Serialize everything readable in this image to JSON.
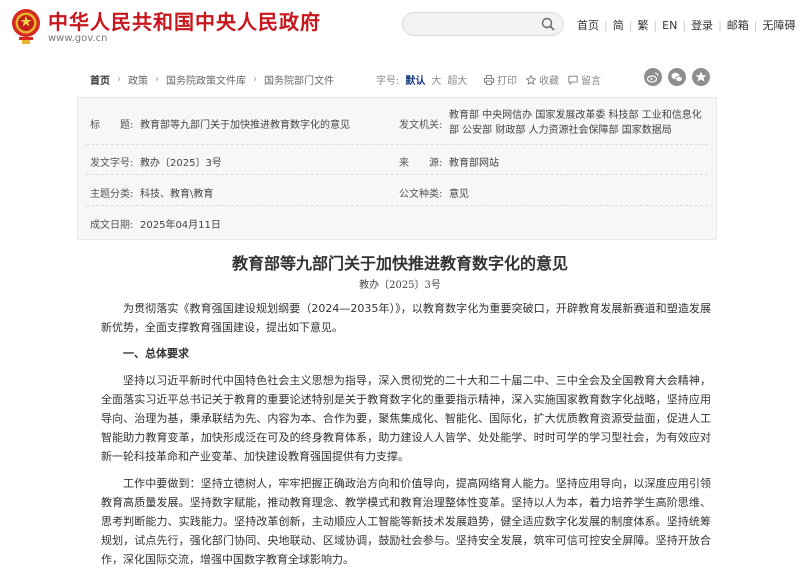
{
  "header": {
    "site_name": "中华人民共和国中央人民政府",
    "site_url": "www.gov.cn",
    "search_placeholder": "",
    "nav": [
      "首页",
      "简",
      "繁",
      "EN",
      "登录",
      "邮箱",
      "无障碍"
    ]
  },
  "breadcrumb": [
    "首页",
    "政策",
    "国务院政策文件库",
    "国务院部门文件"
  ],
  "font_size": {
    "label": "字号:",
    "options": [
      "默认",
      "大",
      "超大"
    ],
    "selected": "默认"
  },
  "tools": [
    "打印",
    "收藏",
    "留言"
  ],
  "colors": {
    "brand_red": "#c8161d",
    "accent_blue": "#1a3c82"
  },
  "meta": {
    "title_label": "标　　题:",
    "title_value": "教育部等九部门关于加快推进教育数字化的意见",
    "issuer_label": "发文机关:",
    "issuer_value": "教育部 中央网信办 国家发展改革委 科技部 工业和信息化部 公安部 财政部 人力资源社会保障部 国家数据局",
    "docno_label": "发文字号:",
    "docno_value": "教办〔2025〕3号",
    "source_label": "来　　源:",
    "source_value": "教育部网站",
    "topic_label": "主题分类:",
    "topic_value": "科技、教育\\教育",
    "type_label": "公文种类:",
    "type_value": "意见",
    "date_label": "成文日期:",
    "date_value": "2025年04月11日"
  },
  "doc": {
    "title": "教育部等九部门关于加快推进教育数字化的意见",
    "number": "教办〔2025〕3号",
    "p1": "为贯彻落实《教育强国建设规划纲要（2024—2035年）》，以教育数字化为重要突破口，开辟教育发展新赛道和塑造发展新优势，全面支撑教育强国建设，提出如下意见。",
    "h1": "一、总体要求",
    "p2": "坚持以习近平新时代中国特色社会主义思想为指导，深入贯彻党的二十大和二十届二中、三中全会及全国教育大会精神，全面落实习近平总书记关于教育的重要论述特别是关于教育数字化的重要指示精神，深入实施国家教育数字化战略，坚持应用导向、治理为基，秉承联结为先、内容为本、合作为要，聚焦集成化、智能化、国际化，扩大优质教育资源受益面，促进人工智能助力教育变革，加快形成泛在可及的终身教育体系，助力建设人人皆学、处处能学、时时可学的学习型社会，为有效应对新一轮科技革命和产业变革、加快建设教育强国提供有力支撑。",
    "p3": "工作中要做到：坚持立德树人，牢牢把握正确政治方向和价值导向，提高网络育人能力。坚持应用导向，以深度应用引领教育高质量发展。坚持数字赋能，推动教育理念、教学模式和教育治理整体性变革。坚持以人为本，着力培养学生高阶思维、思考判断能力、实践能力。坚持改革创新，主动顺应人工智能等新技术发展趋势，健全适应数字化发展的制度体系。坚持统筹规划，试点先行，强化部门协同、央地联动、区域协调，鼓励社会参与。坚持安全发展，筑牢可信可控安全屏障。坚持开放合作，深化国际交流，增强中国数字教育全球影响力。"
  }
}
